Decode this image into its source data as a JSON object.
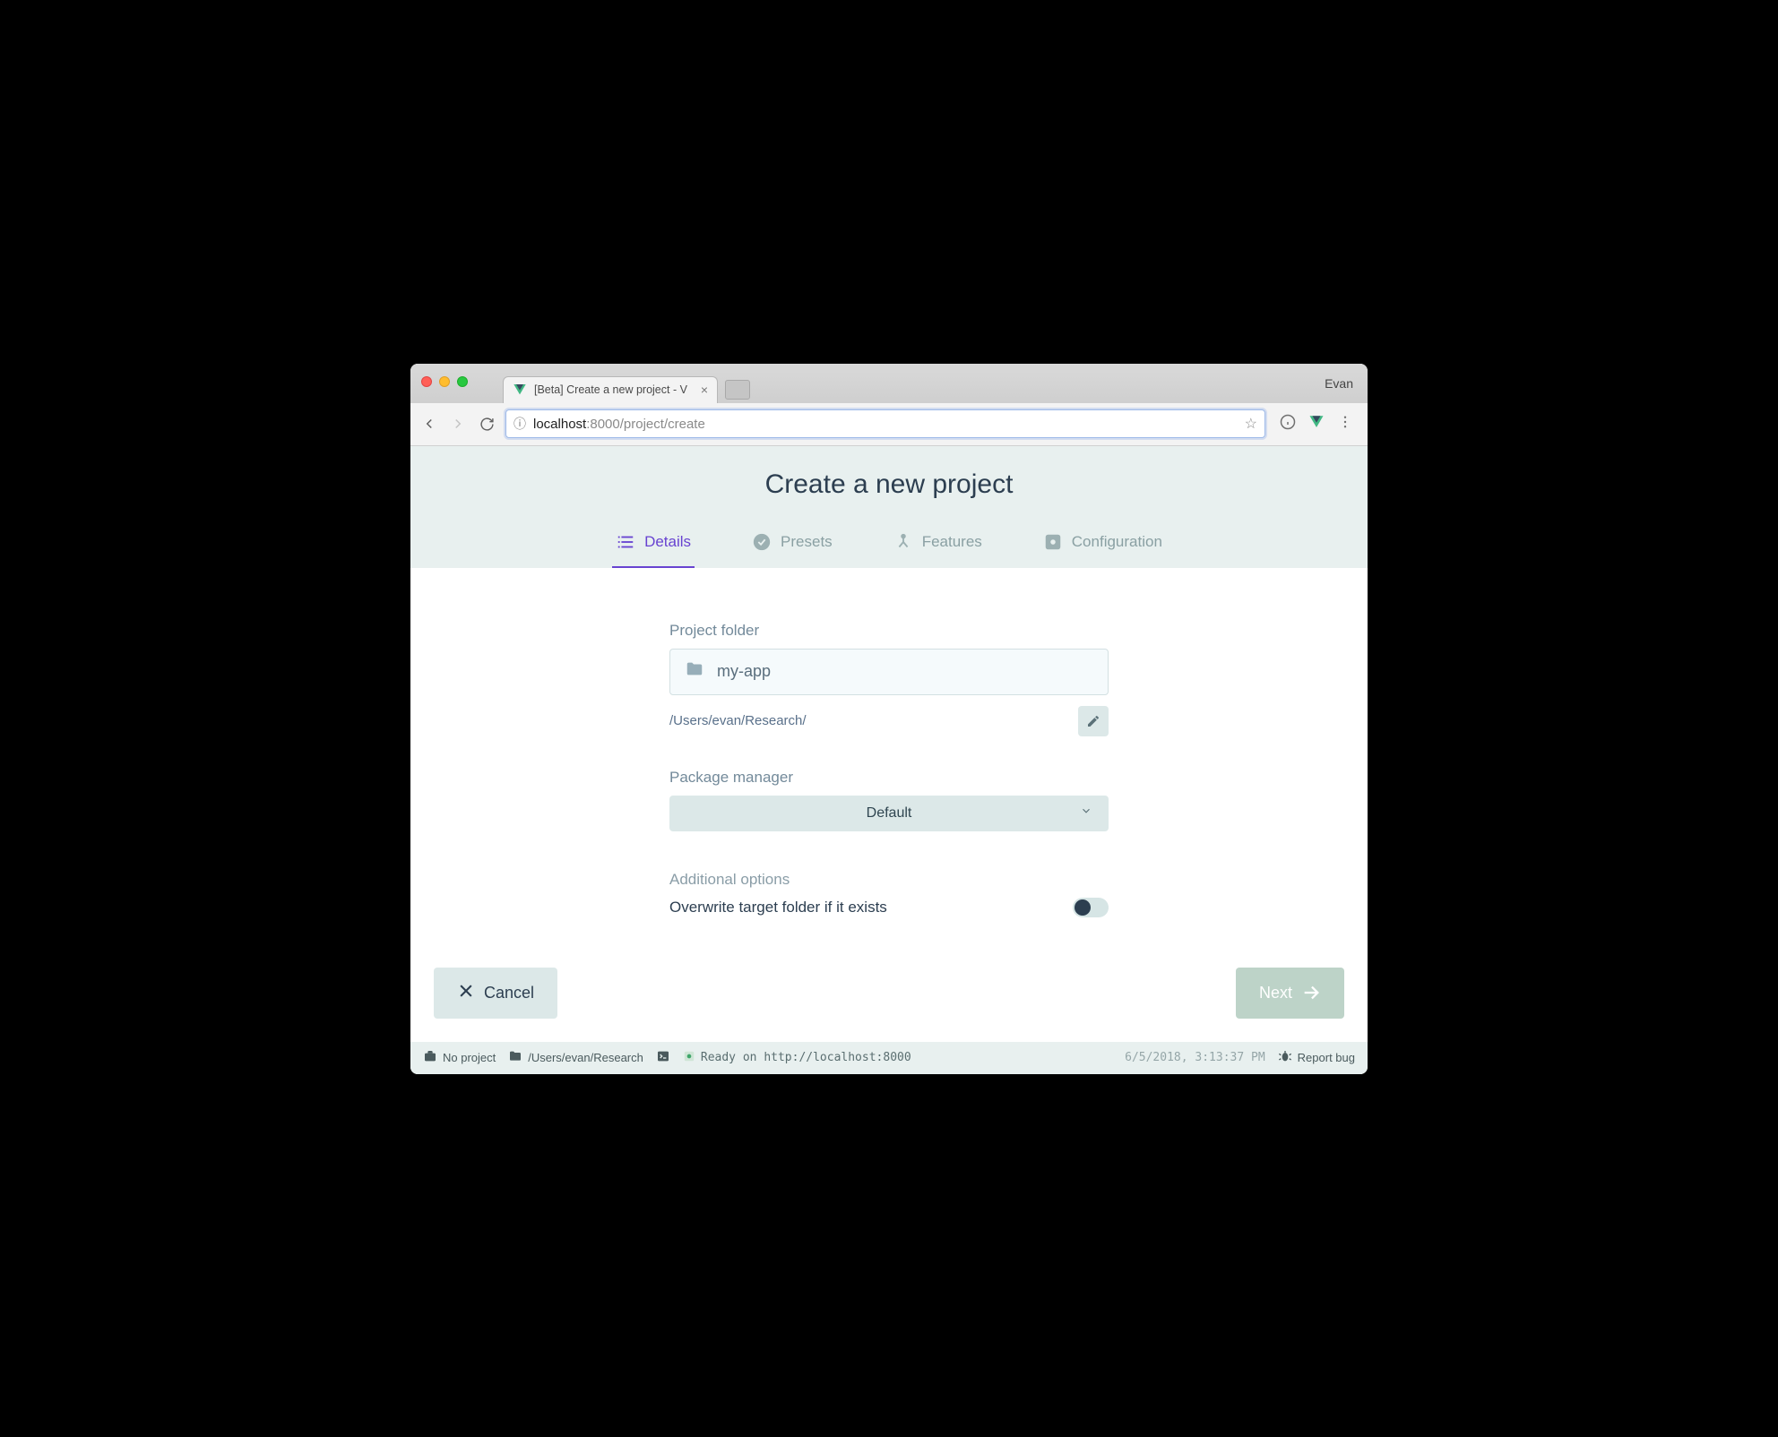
{
  "browser": {
    "profile": "Evan",
    "tab_title": "[Beta] Create a new project - V",
    "url_host": "localhost",
    "url_port": ":8000",
    "url_path": "/project/create"
  },
  "header": {
    "title": "Create a new project",
    "tabs": [
      {
        "label": "Details"
      },
      {
        "label": "Presets"
      },
      {
        "label": "Features"
      },
      {
        "label": "Configuration"
      }
    ]
  },
  "form": {
    "folder_label": "Project folder",
    "folder_value": "my-app",
    "folder_path": "/Users/evan/Research/",
    "pkg_label": "Package manager",
    "pkg_value": "Default",
    "additional_label": "Additional options",
    "overwrite_label": "Overwrite target folder if it exists"
  },
  "actions": {
    "cancel": "Cancel",
    "next": "Next"
  },
  "status": {
    "no_project": "No project",
    "cwd": "/Users/evan/Research",
    "ready": "Ready on http://localhost:8000",
    "timestamp": "6/5/2018, 3:13:37 PM",
    "report": "Report bug"
  }
}
